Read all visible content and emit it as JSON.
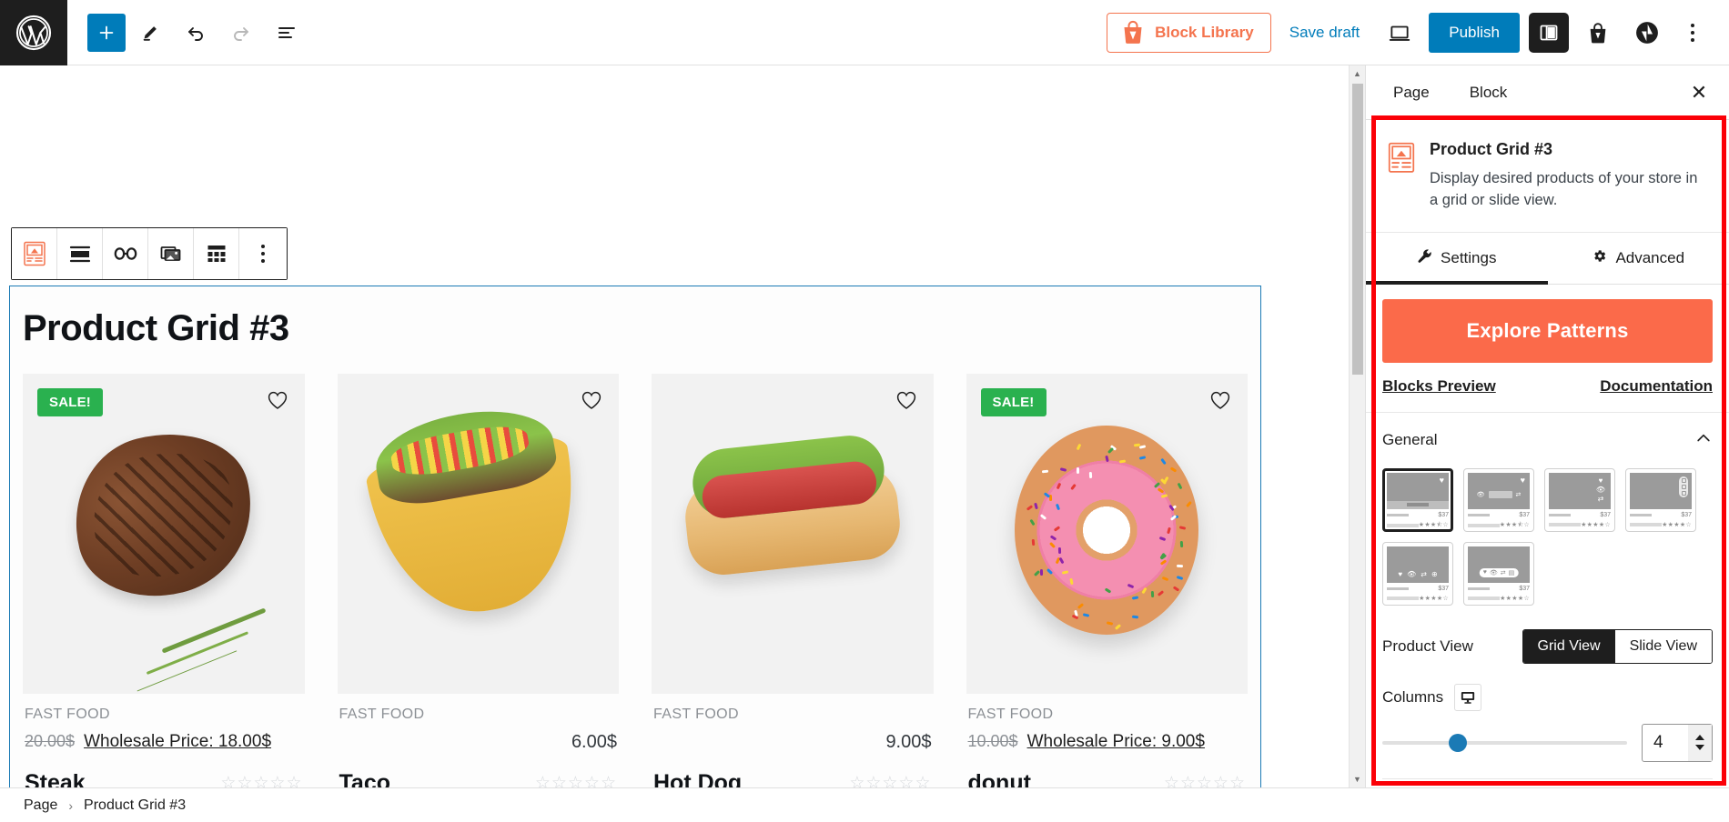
{
  "topbar": {
    "logo_icon": "wordpress-logo-icon",
    "add_block_label": "+",
    "tools": [
      {
        "name": "add-block-button",
        "icon": "plus-icon"
      },
      {
        "name": "edit-tool-button",
        "icon": "pencil-icon"
      },
      {
        "name": "undo-button",
        "icon": "undo-arrow-icon"
      },
      {
        "name": "redo-button",
        "icon": "redo-arrow-icon"
      },
      {
        "name": "document-overview-button",
        "icon": "list-view-icon"
      }
    ],
    "block_library_label": "Block Library",
    "save_draft_label": "Save draft",
    "preview_label": "Preview",
    "publish_label": "Publish",
    "settings_sidebar_label": "Settings",
    "shop_label": "Shop",
    "jetpack_label": "Jetpack",
    "options_label": "Options"
  },
  "canvas": {
    "block_toolbar": [
      {
        "name": "block-type-button",
        "icon": "product-grid-icon"
      },
      {
        "name": "align-button",
        "icon": "align-full-icon"
      },
      {
        "name": "link-button",
        "icon": "link-icon"
      },
      {
        "name": "media-button",
        "icon": "gallery-icon"
      },
      {
        "name": "grid-layout-button",
        "icon": "grid-icon"
      },
      {
        "name": "more-options-button",
        "icon": "kebab-icon"
      }
    ],
    "heading": "Product Grid #3",
    "products": [
      {
        "category": "FAST FOOD",
        "sale_badge": "SALE!",
        "price_old": "20.00$",
        "price_wholesale": "Wholesale Price: 18.00$",
        "price_regular": "",
        "name": "Steak",
        "rating": 0,
        "image": "steak"
      },
      {
        "category": "FAST FOOD",
        "sale_badge": "",
        "price_old": "",
        "price_wholesale": "",
        "price_regular": "6.00$",
        "name": "Taco",
        "rating": 0,
        "image": "taco"
      },
      {
        "category": "FAST FOOD",
        "sale_badge": "",
        "price_old": "",
        "price_wholesale": "",
        "price_regular": "9.00$",
        "name": "Hot Dog",
        "rating": 0,
        "image": "hotdog"
      },
      {
        "category": "FAST FOOD",
        "sale_badge": "SALE!",
        "price_old": "10.00$",
        "price_wholesale": "Wholesale Price: 9.00$",
        "price_regular": "",
        "name": "donut",
        "rating": 0,
        "image": "donut"
      }
    ]
  },
  "sidebar": {
    "tabs": [
      {
        "label": "Page",
        "active": false
      },
      {
        "label": "Block",
        "active": true
      }
    ],
    "close_label": "✕",
    "block": {
      "title": "Product Grid #3",
      "description": "Display desired products of your store in a grid or slide view.",
      "icon": "product-grid-icon"
    },
    "setting_tabs": [
      {
        "label": "Settings",
        "icon": "wrench-icon",
        "active": true
      },
      {
        "label": "Advanced",
        "icon": "gear-icon",
        "active": false
      }
    ],
    "explore_patterns_label": "Explore Patterns",
    "links": [
      {
        "label": "Blocks Preview"
      },
      {
        "label": "Documentation"
      }
    ],
    "general": {
      "title": "General",
      "collapsed": false,
      "layouts": [
        {
          "name": "layout-1",
          "selected": true,
          "price": "$37",
          "stars": "★★★⯪☆"
        },
        {
          "name": "layout-2",
          "selected": false,
          "price": "$37",
          "stars": "★★★⯪☆"
        },
        {
          "name": "layout-3",
          "selected": false,
          "price": "$37",
          "stars": "★★★★☆"
        },
        {
          "name": "layout-4",
          "selected": false,
          "price": "$37",
          "stars": "★★★★☆"
        },
        {
          "name": "layout-5",
          "selected": false,
          "price": "$37",
          "stars": "★★★★☆"
        },
        {
          "name": "layout-6",
          "selected": false,
          "price": "$37",
          "stars": "★★★★☆"
        }
      ],
      "product_view_label": "Product View",
      "product_view_options": [
        {
          "label": "Grid View",
          "selected": true
        },
        {
          "label": "Slide View",
          "selected": false
        }
      ],
      "columns_label": "Columns",
      "columns_device_icon": "desktop-icon",
      "columns_value": "4"
    }
  },
  "bottombar": {
    "breadcrumb": [
      {
        "label": "Page"
      },
      {
        "label": "Product Grid #3"
      }
    ],
    "separator": "›"
  },
  "colors": {
    "accent_blue": "#007cba",
    "brand_orange": "#fb6a4a",
    "block_library_orange": "#f4744e",
    "sale_green": "#2ab14f",
    "highlight_red": "#fb0007",
    "dark": "#1e1e1e"
  }
}
